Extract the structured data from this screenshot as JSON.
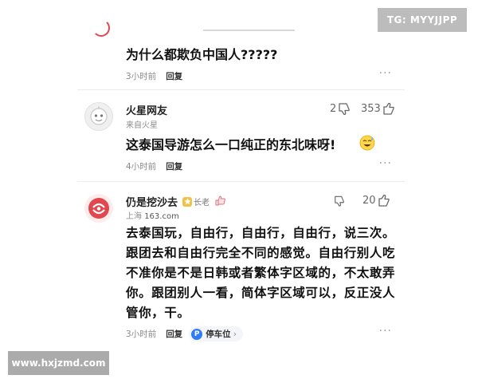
{
  "watermarks": {
    "top_right": "TG: MYYJJPP",
    "bottom_left": "www.hxjzmd.com"
  },
  "comments": [
    {
      "content": "为什么都欺负中国人?????",
      "time": "3小时前",
      "reply": "回复",
      "more": "···"
    },
    {
      "username": "火星网友",
      "source": "来自火星",
      "dislike_count": "2",
      "like_count": "353",
      "content": "这泰国导游怎么一口纯正的东北味呀!",
      "emoji": "emoji-sweat-smile",
      "time": "4小时前",
      "reply": "回复",
      "more": "···"
    },
    {
      "username": "仍是挖沙去",
      "badge": "长老",
      "source_location": "上海",
      "source_site": "163.com",
      "like_count": "20",
      "content": "去泰国玩，自由行，自由行，自由行，说三次。跟团去和自由行完全不同的感觉。自由行别人吃不准你是不是日韩或者繁体字区域的，不太敢弄你。跟团别人一看，简体字区域可以，反正没人管你，干。",
      "time": "3小时前",
      "reply": "回复",
      "tag": "停车位",
      "tag_icon": "P",
      "more": "···"
    }
  ],
  "colors": {
    "badge_yellow": "#f1c24a",
    "tag_blue": "#2f7cf6",
    "avatar_red": "#e2464f"
  }
}
